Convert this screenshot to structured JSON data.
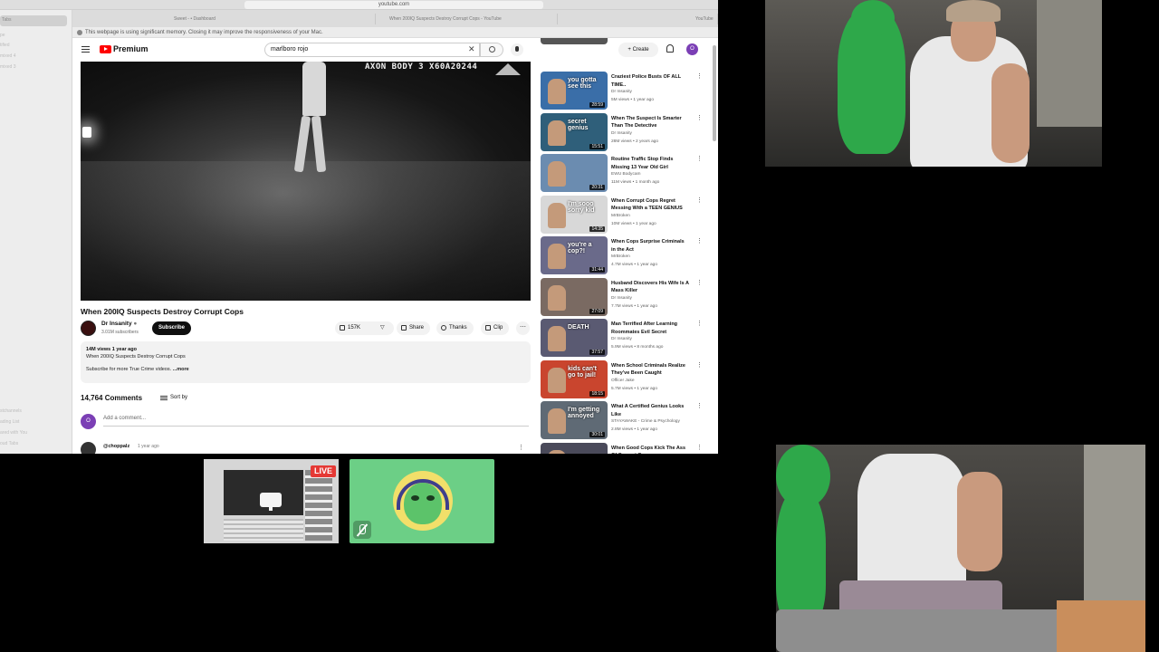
{
  "browser": {
    "url": "youtube.com",
    "tabs": [
      "Sweet - • Dashboard",
      "When 200IQ Suspects Destroy Corrupt Cops - YouTube",
      "YouTube"
    ],
    "warning": "This webpage is using significant memory. Closing it may improve the responsiveness of your Mac."
  },
  "sidebar": {
    "items": [
      "Tabs",
      "pe",
      "tified",
      "mixed 4",
      "mixed 3",
      "stchannels",
      "ading List",
      "ared with You",
      "oud Tabs"
    ]
  },
  "youtube": {
    "logo_text": "Premium",
    "search_value": "marlboro rojo",
    "create_label": "Create",
    "avatar_letter": "O",
    "video_overlay": "AXON BODY 3  X60A20244",
    "video_title": "When 200IQ Suspects Destroy Corrupt Cops",
    "channel": "Dr Insanity",
    "subscribers": "3.01M subscribers",
    "subscribe_label": "Subscribe",
    "likes": "157K",
    "share_label": "Share",
    "thanks_label": "Thanks",
    "clip_label": "Clip",
    "description": {
      "meta": "14M views  1 year ago",
      "line1": "When 200IQ Suspects Destroy Corrupt Cops",
      "line2": "Subscribe for more True Crime videos. ",
      "more": "...more"
    },
    "comments_count": "14,764 Comments",
    "sort_label": "Sort by",
    "add_comment_placeholder": "Add a comment...",
    "comment_user": "@choppalz",
    "comment_time": "1 year ago"
  },
  "recommendations": [
    {
      "title": "Craziest Police Busts OF ALL TIME..",
      "channel": "Dr Insanity",
      "meta": "5M views • 1 year ago",
      "duration": "28:59",
      "caption": "you gotta see this",
      "color": "#3a6ea8"
    },
    {
      "title": "When The Suspect Is Smarter Than The Detective",
      "channel": "Dr Insanity",
      "meta": "28M views • 2 years ago",
      "duration": "15:51",
      "caption": "secret genius",
      "color": "#2f5f7a"
    },
    {
      "title": "Routine Traffic Stop Finds Missing 13 Year Old Girl",
      "channel": "EWU Bodycam",
      "meta": "11M views • 1 month ago",
      "duration": "20:31",
      "caption": "",
      "color": "#6b8cb0"
    },
    {
      "title": "When Corrupt Cops Regret Messing With a TEEN GENIUS",
      "channel": "MrBroken",
      "meta": "10M views • 1 year ago",
      "duration": "14:35",
      "caption": "I'm sooo sorry kid",
      "color": "#d8d8d8"
    },
    {
      "title": "When Cops Surprise Criminals in the Act",
      "channel": "MrBroken",
      "meta": "4.7M views • 1 year ago",
      "duration": "31:44",
      "caption": "you're a cop?!",
      "color": "#6a6a8a"
    },
    {
      "title": "Husband Discovers His Wife Is A Mass Killer",
      "channel": "Dr Insanity",
      "meta": "7.7M views • 1 year ago",
      "duration": "27:09",
      "caption": "",
      "color": "#7a6a62"
    },
    {
      "title": "Man Terrified After Learning Roommates Evil Secret",
      "channel": "Dr Insanity",
      "meta": "5.9M views • 8 months ago",
      "duration": "37:57",
      "caption": "DEATH",
      "color": "#5a5a72"
    },
    {
      "title": "When School Criminals Realize They've Been Caught",
      "channel": "Officer Jake",
      "meta": "5.7M views • 1 year ago",
      "duration": "18:15",
      "caption": "kids can't go to jail!",
      "color": "#c9452e"
    },
    {
      "title": "What A Certified Genius Looks Like",
      "channel": "STAYAWAKE - Crime & Psychology",
      "meta": "2.8M views • 1 year ago",
      "duration": "30:01",
      "caption": "I'm getting annoyed",
      "color": "#5f6a75"
    },
    {
      "title": "When Good Cops Kick The Ass Of Corrupt Cops",
      "channel": "",
      "meta": "",
      "duration": "",
      "caption": "",
      "color": "#4a4a5a"
    }
  ],
  "call": {
    "live_label": "LIVE",
    "avatar_tile_color": "#6ccf86"
  }
}
